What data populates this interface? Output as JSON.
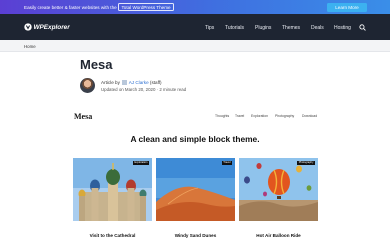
{
  "promo": {
    "text": "Easily create better & faster websites with the",
    "link": "Total WordPress Theme",
    "button": "Learn More"
  },
  "header": {
    "logo": "WPExplorer",
    "nav": [
      "Tips",
      "Tutorials",
      "Plugins",
      "Themes",
      "Deals",
      "Hosting"
    ]
  },
  "breadcrumb": "Home",
  "article": {
    "title": "Mesa",
    "byline_prefix": "Article by",
    "author": "AJ Clarke",
    "author_role": "(staff)",
    "updated": "Updated on March 20, 2020 · 2 minute read"
  },
  "preview": {
    "site_title": "Mesa",
    "nav": [
      "Thoughts",
      "Travel",
      "Exploration",
      "Photography",
      "Download"
    ],
    "tagline": "A clean and simple block theme.",
    "cards": [
      {
        "badge": "Exploration",
        "caption": "Visit to the Cathedral"
      },
      {
        "badge": "Travel",
        "caption": "Windy Sand Dunes"
      },
      {
        "badge": "Photography",
        "caption": "Hot Air Balloon Ride"
      }
    ]
  }
}
